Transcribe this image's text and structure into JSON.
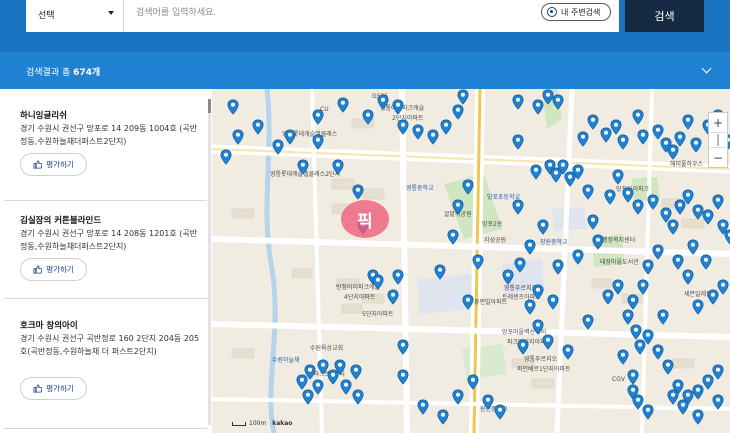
{
  "search": {
    "select_label": "선택",
    "placeholder": "검색어를 입력하세요.",
    "nearby_label": "내 주변검색",
    "button_label": "검색"
  },
  "results": {
    "prefix": "검색결과 총 ",
    "count": "674개"
  },
  "list": [
    {
      "name": "하니잉글리쉬",
      "address": "경기 수원시 권선구 망포로 14 209동 1004호 (곡반정동,수원하늘채더퍼스트2단지)",
      "rate_label": "평가하기"
    },
    {
      "name": "김실장의 커튼블라인드",
      "address": "경기 수원시 권선구 망포로 14 208동 1201호 (곡반정동,수원하늘채더퍼스트2단지)",
      "rate_label": "평가하기"
    },
    {
      "name": "호크마 창의아이",
      "address": "경기 수원시 권선구 곡반정로 160 2단지 204동 205호(곡반정동,수원하늘채 더 퍼스트2단지)",
      "rate_label": "평가하기"
    }
  ],
  "map": {
    "pick_label": "픽",
    "zoom_in": "+",
    "zoom_out": "−",
    "scale_label": "100m",
    "brand": "kakao",
    "marker_color": "#1f82d2",
    "labels": [
      "GS25",
      "CU",
      "영통롯데캐슬엘클래스",
      "영통롯데캐슬엘클래스2단지",
      "영통아이파크캐슬",
      "2단지아파트",
      "영통중학교",
      "망포초등학교",
      "굴밭뒤공원",
      "망포2동",
      "지성공원",
      "행정복지센터",
      "태장마을도서관",
      "장원중학교",
      "반정아이파크캐슬",
      "4단지아파트",
      "5단지아파트",
      "영통푸르지오",
      "트레센츠아파트",
      "휴먼빌아파트",
      "망포마을벽산아이",
      "파크빌리지아파트",
      "수원육상교회",
      "수원하늘채",
      "더퍼스트2단지",
      "영통푸르지오",
      "파인베르1단지아파트",
      "CGV",
      "세븐일레븐",
      "원천중학교",
      "망포아이파크",
      "해피풀하우스"
    ]
  }
}
